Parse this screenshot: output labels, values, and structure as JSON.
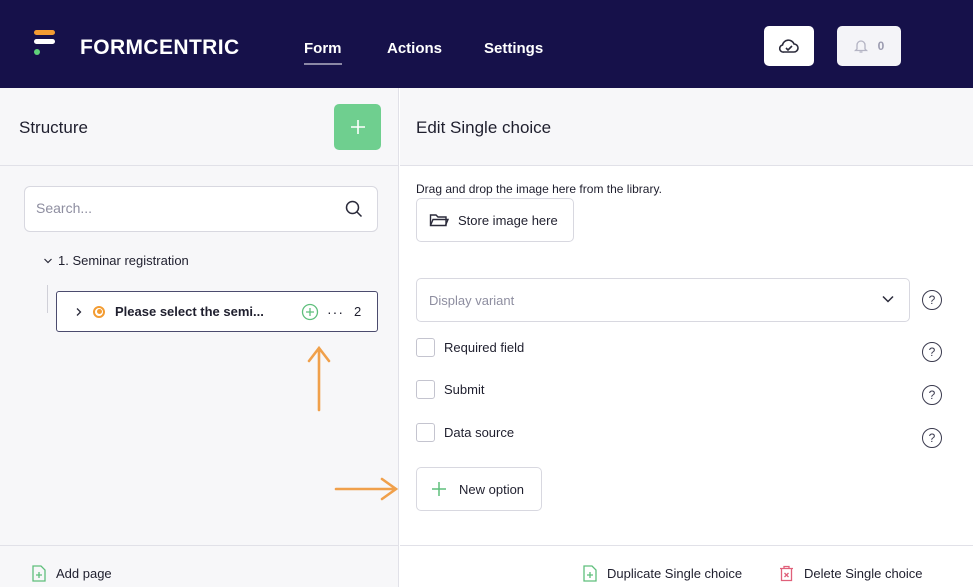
{
  "header": {
    "brand": "FORMCENTRIC",
    "nav": [
      {
        "label": "Form"
      },
      {
        "label": "Actions"
      },
      {
        "label": "Settings"
      }
    ],
    "notifications_count": "0",
    "brand_color": "#16114a"
  },
  "structure": {
    "title": "Structure",
    "search_placeholder": "Search...",
    "tree_root": "1. Seminar registration",
    "tree_item": {
      "label": "Please select the semi...",
      "count": "2"
    },
    "add_page": "Add page"
  },
  "editor": {
    "title": "Edit Single choice",
    "drag_hint": "Drag and drop the image here from the library.",
    "store_image": "Store image here",
    "display_variant_placeholder": "Display variant",
    "help_symbol": "?",
    "checkboxes": [
      {
        "label": "Required field"
      },
      {
        "label": "Submit"
      },
      {
        "label": "Data source"
      }
    ],
    "new_option": "New option",
    "duplicate": "Duplicate Single choice",
    "delete": "Delete Single choice"
  }
}
